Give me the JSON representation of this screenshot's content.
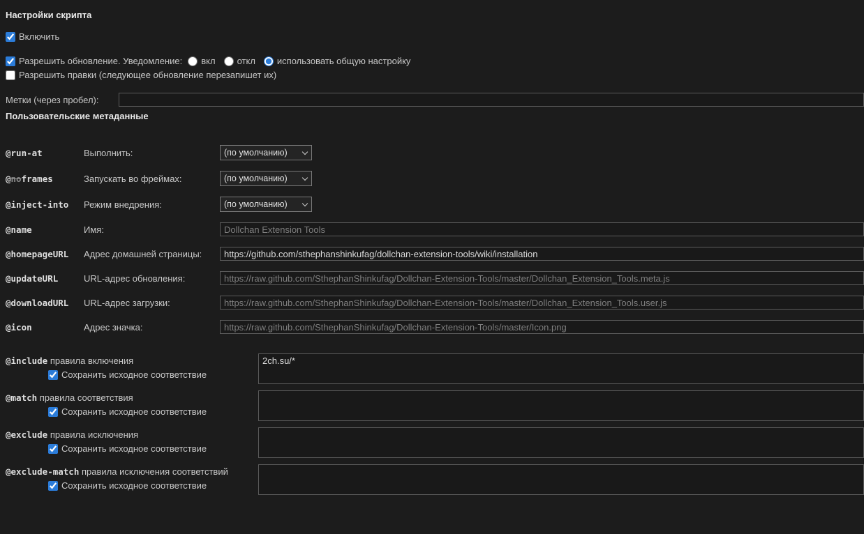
{
  "colors": {
    "page_bg": "#1c1c1c",
    "accent": "#2b7cd9",
    "input_bg": "#191919",
    "border": "#5c5c5c"
  },
  "script_settings": {
    "title": "Настройки скрипта",
    "enable": {
      "label": "Включить",
      "checked": true
    },
    "update": {
      "label": "Разрешить обновление. Уведомление:",
      "checked": true,
      "options": [
        {
          "label": "вкл",
          "selected": false
        },
        {
          "label": "откл",
          "selected": false
        },
        {
          "label": "использовать общую настройку",
          "selected": true
        }
      ]
    },
    "edits": {
      "label": "Разрешить правки (следующее обновление перезапишет их)",
      "checked": false
    },
    "tags": {
      "label": "Метки (через пробел):",
      "value": ""
    }
  },
  "metadata": {
    "title": "Пользовательские метаданные",
    "selects": [
      {
        "key": "@run-at",
        "label": "Выполнить:",
        "value": "(по умолчанию)"
      },
      {
        "key_prefix": "@",
        "key_struck": "no",
        "key_rest": "frames",
        "label": "Запускать во фреймах:",
        "value": "(по умолчанию)"
      },
      {
        "key": "@inject-into",
        "label": "Режим внедрения:",
        "value": "(по умолчанию)"
      }
    ],
    "inputs": [
      {
        "key": "@name",
        "label": "Имя:",
        "value": "",
        "placeholder": "Dollchan Extension Tools"
      },
      {
        "key": "@homepageURL",
        "label": "Адрес домашней страницы:",
        "value": "https://github.com/sthephanshinkufag/dollchan-extension-tools/wiki/installation",
        "placeholder": ""
      },
      {
        "key": "@updateURL",
        "label": "URL-адрес обновления:",
        "value": "",
        "placeholder": "https://raw.github.com/SthephanShinkufag/Dollchan-Extension-Tools/master/Dollchan_Extension_Tools.meta.js"
      },
      {
        "key": "@downloadURL",
        "label": "URL-адрес загрузки:",
        "value": "",
        "placeholder": "https://raw.github.com/SthephanShinkufag/Dollchan-Extension-Tools/master/Dollchan_Extension_Tools.user.js"
      },
      {
        "key": "@icon",
        "label": "Адрес значка:",
        "value": "",
        "placeholder": "https://raw.github.com/SthephanShinkufag/Dollchan-Extension-Tools/master/Icon.png"
      }
    ],
    "rules": [
      {
        "key": "@include",
        "label": "правила включения",
        "keep_label": "Сохранить исходное соответствие",
        "keep_checked": true,
        "value": "2ch.su/*"
      },
      {
        "key": "@match",
        "label": "правила соответствия",
        "keep_label": "Сохранить исходное соответствие",
        "keep_checked": true,
        "value": ""
      },
      {
        "key": "@exclude",
        "label": "правила исключения",
        "keep_label": "Сохранить исходное соответствие",
        "keep_checked": true,
        "value": ""
      },
      {
        "key": "@exclude-match",
        "label": "правила исключения соответствий",
        "keep_label": "Сохранить исходное соответствие",
        "keep_checked": true,
        "value": ""
      }
    ]
  }
}
